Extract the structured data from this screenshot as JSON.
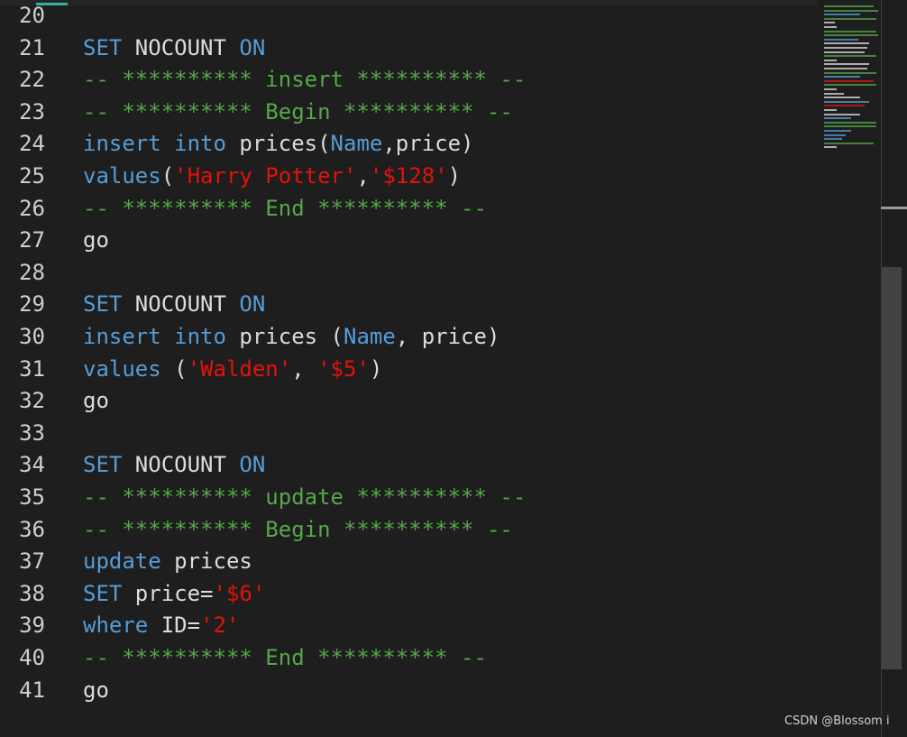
{
  "editor": {
    "lines": [
      {
        "n": "20",
        "t": []
      },
      {
        "n": "21",
        "t": [
          [
            "kw",
            "SET"
          ],
          [
            "plain",
            " NOCOUNT "
          ],
          [
            "kw",
            "ON"
          ]
        ]
      },
      {
        "n": "22",
        "t": [
          [
            "cmt",
            "-- ********** insert ********** --"
          ]
        ]
      },
      {
        "n": "23",
        "t": [
          [
            "cmt",
            "-- ********** Begin ********** --"
          ]
        ]
      },
      {
        "n": "24",
        "t": [
          [
            "kw",
            "insert"
          ],
          [
            "plain",
            " "
          ],
          [
            "kw",
            "into"
          ],
          [
            "plain",
            " prices("
          ],
          [
            "kw",
            "Name"
          ],
          [
            "plain",
            ",price)"
          ]
        ]
      },
      {
        "n": "25",
        "t": [
          [
            "kw",
            "values"
          ],
          [
            "plain",
            "("
          ],
          [
            "str",
            "'Harry Potter'"
          ],
          [
            "plain",
            ","
          ],
          [
            "str",
            "'$128'"
          ],
          [
            "plain",
            ")"
          ]
        ]
      },
      {
        "n": "26",
        "t": [
          [
            "cmt",
            "-- ********** End ********** --"
          ]
        ]
      },
      {
        "n": "27",
        "t": [
          [
            "plain",
            "go"
          ]
        ]
      },
      {
        "n": "28",
        "t": []
      },
      {
        "n": "29",
        "t": [
          [
            "kw",
            "SET"
          ],
          [
            "plain",
            " NOCOUNT "
          ],
          [
            "kw",
            "ON"
          ]
        ]
      },
      {
        "n": "30",
        "t": [
          [
            "kw",
            "insert"
          ],
          [
            "plain",
            " "
          ],
          [
            "kw",
            "into"
          ],
          [
            "plain",
            " prices ("
          ],
          [
            "kw",
            "Name"
          ],
          [
            "plain",
            ", price)"
          ]
        ]
      },
      {
        "n": "31",
        "t": [
          [
            "kw",
            "values"
          ],
          [
            "plain",
            " ("
          ],
          [
            "str",
            "'Walden'"
          ],
          [
            "plain",
            ", "
          ],
          [
            "str",
            "'$5'"
          ],
          [
            "plain",
            ")"
          ]
        ]
      },
      {
        "n": "32",
        "t": [
          [
            "plain",
            "go"
          ]
        ]
      },
      {
        "n": "33",
        "t": []
      },
      {
        "n": "34",
        "t": [
          [
            "kw",
            "SET"
          ],
          [
            "plain",
            " NOCOUNT "
          ],
          [
            "kw",
            "ON"
          ]
        ]
      },
      {
        "n": "35",
        "t": [
          [
            "cmt",
            "-- ********** update ********** --"
          ]
        ]
      },
      {
        "n": "36",
        "t": [
          [
            "cmt",
            "-- ********** Begin ********** --"
          ]
        ]
      },
      {
        "n": "37",
        "t": [
          [
            "kw",
            "update"
          ],
          [
            "plain",
            " prices"
          ]
        ]
      },
      {
        "n": "38",
        "t": [
          [
            "kw",
            "SET"
          ],
          [
            "plain",
            " price="
          ],
          [
            "str",
            "'$6'"
          ]
        ]
      },
      {
        "n": "39",
        "t": [
          [
            "kw",
            "where"
          ],
          [
            "plain",
            " ID="
          ],
          [
            "str",
            "'2'"
          ]
        ]
      },
      {
        "n": "40",
        "t": [
          [
            "cmt",
            "-- ********** End ********** --"
          ]
        ]
      },
      {
        "n": "41",
        "t": [
          [
            "plain",
            "go"
          ]
        ]
      }
    ]
  },
  "colors": {
    "background": "#1e1e1e",
    "keyword": "#569cd6",
    "string": "#e3120b",
    "comment": "#57a64a",
    "text": "#dcdcdc",
    "line_number": "#cfcfcf"
  },
  "watermark": "CSDN @Blossom i"
}
